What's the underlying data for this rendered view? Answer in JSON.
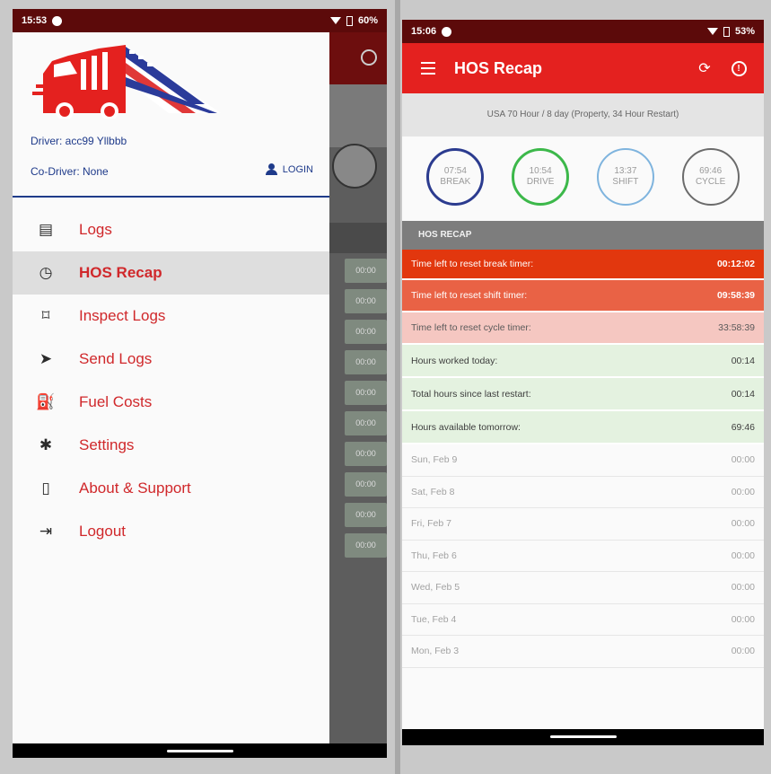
{
  "left": {
    "status": {
      "time": "15:53",
      "battery": "60%"
    },
    "drawer": {
      "driver": "Driver: acc99 Yllbbb",
      "co_driver": "Co-Driver: None",
      "login_label": "LOGIN",
      "menu": [
        {
          "label": "Logs",
          "icon": "logs-icon"
        },
        {
          "label": "HOS Recap",
          "icon": "clock-icon"
        },
        {
          "label": "Inspect Logs",
          "icon": "inspect-icon"
        },
        {
          "label": "Send Logs",
          "icon": "send-icon"
        },
        {
          "label": "Fuel Costs",
          "icon": "fuel-icon"
        },
        {
          "label": "Settings",
          "icon": "gear-icon"
        },
        {
          "label": "About & Support",
          "icon": "phone-icon"
        },
        {
          "label": "Logout",
          "icon": "logout-icon"
        }
      ],
      "active_index": 1
    },
    "background_values": [
      "00:00",
      "00:00",
      "00:00",
      "00:00",
      "00:00",
      "00:00",
      "00:00",
      "00:00",
      "00:00",
      "00:00"
    ]
  },
  "right": {
    "status": {
      "time": "15:06",
      "battery": "53%"
    },
    "app_title": "HOS Recap",
    "rule_banner": "USA 70 Hour / 8 day (Property, 34 Hour Restart)",
    "gauges": [
      {
        "value": "07:54",
        "label": "BREAK"
      },
      {
        "value": "10:54",
        "label": "DRIVE"
      },
      {
        "value": "13:37",
        "label": "SHIFT"
      },
      {
        "value": "69:46",
        "label": "CYCLE"
      }
    ],
    "section_title": "HOS RECAP",
    "timers": [
      {
        "label": "Time left to reset break timer:",
        "value": "00:12:02"
      },
      {
        "label": "Time left to reset shift timer:",
        "value": "09:58:39"
      },
      {
        "label": "Time left to reset cycle timer:",
        "value": "33:58:39"
      }
    ],
    "hours": [
      {
        "label": "Hours worked today:",
        "value": "00:14"
      },
      {
        "label": "Total hours since last restart:",
        "value": "00:14"
      },
      {
        "label": "Hours available tomorrow:",
        "value": "69:46"
      }
    ],
    "days": [
      {
        "label": "Sun, Feb 9",
        "value": "00:00"
      },
      {
        "label": "Sat, Feb 8",
        "value": "00:00"
      },
      {
        "label": "Fri, Feb 7",
        "value": "00:00"
      },
      {
        "label": "Thu, Feb 6",
        "value": "00:00"
      },
      {
        "label": "Wed, Feb 5",
        "value": "00:00"
      },
      {
        "label": "Tue, Feb 4",
        "value": "00:00"
      },
      {
        "label": "Mon, Feb 3",
        "value": "00:00"
      }
    ]
  },
  "colors": {
    "brand_red": "#e4211f",
    "status_dark": "#5c0a0a",
    "navy": "#1e3a8a",
    "timer_1": "#e2370e",
    "timer_2": "#e96245",
    "timer_3": "#f5c7c1",
    "hours_green": "#e4f2e0"
  }
}
